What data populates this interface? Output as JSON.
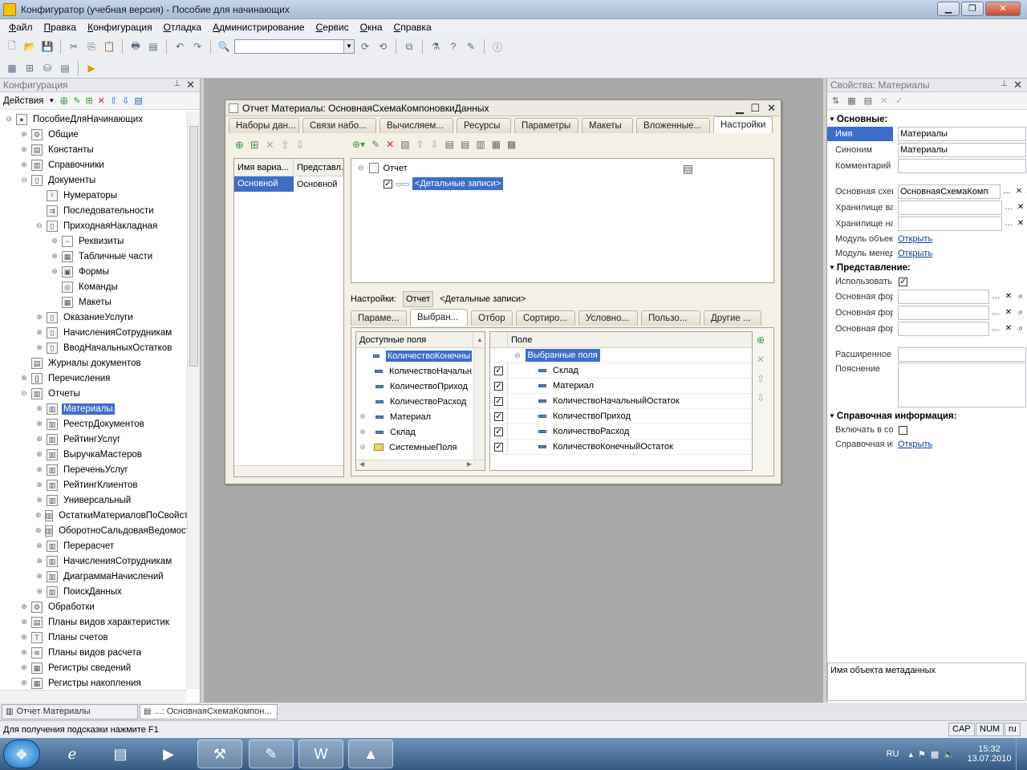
{
  "window": {
    "title": "Конфигуратор (учебная версия) - Пособие для начинающих"
  },
  "menu": [
    "Файл",
    "Правка",
    "Конфигурация",
    "Отладка",
    "Администрирование",
    "Сервис",
    "Окна",
    "Справка"
  ],
  "left_panel": {
    "title": "Конфигурация",
    "actions_label": "Действия",
    "tree": [
      {
        "label": "ПособиеДляНачинающих",
        "level": 0,
        "exp": "⊖",
        "icon": "●"
      },
      {
        "label": "Общие",
        "level": 1,
        "exp": "⊕",
        "icon": "⚙"
      },
      {
        "label": "Константы",
        "level": 1,
        "exp": "⊕",
        "icon": "▤"
      },
      {
        "label": "Справочники",
        "level": 1,
        "exp": "⊕",
        "icon": "▥"
      },
      {
        "label": "Документы",
        "level": 1,
        "exp": "⊖",
        "icon": "▯"
      },
      {
        "label": "Нумераторы",
        "level": 2,
        "exp": "",
        "icon": "²"
      },
      {
        "label": "Последовательности",
        "level": 2,
        "exp": "",
        "icon": "⇉"
      },
      {
        "label": "ПриходнаяНакладная",
        "level": 2,
        "exp": "⊖",
        "icon": "▯"
      },
      {
        "label": "Реквизиты",
        "level": 3,
        "exp": "⊕",
        "icon": "−"
      },
      {
        "label": "Табличные части",
        "level": 3,
        "exp": "⊕",
        "icon": "▦"
      },
      {
        "label": "Формы",
        "level": 3,
        "exp": "⊕",
        "icon": "▣"
      },
      {
        "label": "Команды",
        "level": 3,
        "exp": "",
        "icon": "◎"
      },
      {
        "label": "Макеты",
        "level": 3,
        "exp": "",
        "icon": "▦"
      },
      {
        "label": "ОказаниеУслуги",
        "level": 2,
        "exp": "⊕",
        "icon": "▯"
      },
      {
        "label": "НачисленияСотрудникам",
        "level": 2,
        "exp": "⊕",
        "icon": "▯"
      },
      {
        "label": "ВводНачальныхОстатков",
        "level": 2,
        "exp": "⊕",
        "icon": "▯"
      },
      {
        "label": "Журналы документов",
        "level": 1,
        "exp": "",
        "icon": "▤"
      },
      {
        "label": "Перечисления",
        "level": 1,
        "exp": "⊕",
        "icon": "[]"
      },
      {
        "label": "Отчеты",
        "level": 1,
        "exp": "⊖",
        "icon": "▥"
      },
      {
        "label": "Материалы",
        "level": 2,
        "exp": "⊕",
        "icon": "▥",
        "selected": true
      },
      {
        "label": "РеестрДокументов",
        "level": 2,
        "exp": "⊕",
        "icon": "▥"
      },
      {
        "label": "РейтингУслуг",
        "level": 2,
        "exp": "⊕",
        "icon": "▥"
      },
      {
        "label": "ВыручкаМастеров",
        "level": 2,
        "exp": "⊕",
        "icon": "▥"
      },
      {
        "label": "ПереченьУслуг",
        "level": 2,
        "exp": "⊕",
        "icon": "▥"
      },
      {
        "label": "РейтингКлиентов",
        "level": 2,
        "exp": "⊕",
        "icon": "▥"
      },
      {
        "label": "Универсальный",
        "level": 2,
        "exp": "⊕",
        "icon": "▥"
      },
      {
        "label": "ОстаткиМатериаловПоСвойств...",
        "level": 2,
        "exp": "⊕",
        "icon": "▥"
      },
      {
        "label": "ОборотноСальдоваяВедомость",
        "level": 2,
        "exp": "⊕",
        "icon": "▥"
      },
      {
        "label": "Перерасчет",
        "level": 2,
        "exp": "⊕",
        "icon": "▥"
      },
      {
        "label": "НачисленияСотрудникам",
        "level": 2,
        "exp": "⊕",
        "icon": "▥"
      },
      {
        "label": "ДиаграммаНачислений",
        "level": 2,
        "exp": "⊕",
        "icon": "▥"
      },
      {
        "label": "ПоискДанных",
        "level": 2,
        "exp": "⊕",
        "icon": "▥"
      },
      {
        "label": "Обработки",
        "level": 1,
        "exp": "⊕",
        "icon": "⚙"
      },
      {
        "label": "Планы видов характеристик",
        "level": 1,
        "exp": "⊕",
        "icon": "▤"
      },
      {
        "label": "Планы счетов",
        "level": 1,
        "exp": "⊕",
        "icon": "Т"
      },
      {
        "label": "Планы видов расчета",
        "level": 1,
        "exp": "⊕",
        "icon": "≋"
      },
      {
        "label": "Регистры сведений",
        "level": 1,
        "exp": "⊕",
        "icon": "▦"
      },
      {
        "label": "Регистры накопления",
        "level": 1,
        "exp": "⊕",
        "icon": "▦"
      }
    ]
  },
  "dialog": {
    "title": "Отчет Материалы: ОсновнаяСхемаКомпоновкиДанных",
    "tabs": [
      "Наборы дан...",
      "Связи набо...",
      "Вычисляем...",
      "Ресурсы",
      "Параметры",
      "Макеты",
      "Вложенные...",
      "Настройки"
    ],
    "variants": {
      "columns": [
        "Имя вариа...",
        "Представл..."
      ],
      "rows": [
        [
          "Основной",
          "Основной"
        ]
      ]
    },
    "structure": {
      "root": "Отчет",
      "child": "<Детальные записи>"
    },
    "settings_label": "Настройки:",
    "settings_btn": "Отчет",
    "settings_value": "<Детальные записи>",
    "subtabs": [
      "Параме...",
      "Выбран...",
      "Отбор",
      "Сортиро...",
      "Условно...",
      "Пользо...",
      "Другие ..."
    ],
    "available": {
      "header": "Доступные поля",
      "items": [
        {
          "label": "КоличествоКонечны",
          "type": "dash",
          "exp": ""
        },
        {
          "label": "КоличествоНачальн",
          "type": "dash",
          "exp": ""
        },
        {
          "label": "КоличествоПриход",
          "type": "dash",
          "exp": ""
        },
        {
          "label": "КоличествоРасход",
          "type": "dash",
          "exp": ""
        },
        {
          "label": "Материал",
          "type": "dash",
          "exp": "⊕"
        },
        {
          "label": "Склад",
          "type": "dash",
          "exp": "⊕"
        },
        {
          "label": "СистемныеПоля",
          "type": "folder",
          "exp": "⊕"
        }
      ]
    },
    "selected": {
      "header": "Поле",
      "group": "Выбранные поля",
      "items": [
        "Склад",
        "Материал",
        "КоличествоНачальныйОстаток",
        "КоличествоПриход",
        "КоличествоРасход",
        "КоличествоКонечныйОстаток"
      ]
    }
  },
  "properties": {
    "title": "Свойства: Материалы",
    "sections": {
      "basic": "Основные:",
      "presentation": "Представление:",
      "reference": "Справочная информация:"
    },
    "rows": {
      "name_label": "Имя",
      "name_value": "Материалы",
      "synonym_label": "Синоним",
      "synonym_value": "Материалы",
      "comment_label": "Комментарий",
      "comment_value": "",
      "main_schema_label": "Основная схем",
      "main_schema_value": "ОсновнаяСхемаКомп",
      "storage1_label": "Хранилище вар",
      "storage2_label": "Хранилище нас",
      "module_obj_label": "Модуль объект",
      "module_mgr_label": "Модуль менед:",
      "open_link": "Открыть",
      "use_label": "Использовать",
      "main_form1_label": "Основная форм",
      "main_form2_label": "Основная форм",
      "main_form3_label": "Основная форм",
      "ext_label": "Расширенное п",
      "explanation_label": "Пояснение",
      "include_label": "Включать в сод",
      "ref_label": "Справочная ин"
    },
    "footer_text": "Имя объекта метаданных"
  },
  "window_tabs": [
    "Отчет Материалы",
    "...: ОсновнаяСхемаКомпон..."
  ],
  "status": {
    "hint": "Для получения подсказки нажмите F1",
    "cap": "CAP",
    "num": "NUM",
    "lang": "ru"
  },
  "taskbar": {
    "lang": "RU",
    "time": "15:32",
    "date": "13.07.2010"
  },
  "colors": {
    "selection": "#3d6ec9",
    "link": "#0b3fa0"
  }
}
